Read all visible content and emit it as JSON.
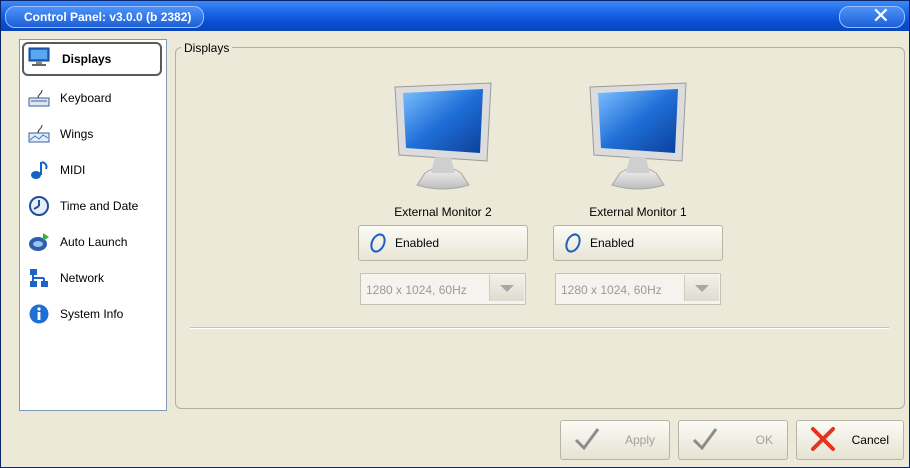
{
  "window": {
    "title": "Control Panel: v3.0.0 (b 2382)"
  },
  "sidebar": {
    "items": [
      {
        "label": "Displays",
        "icon": "monitor-icon",
        "selected": true
      },
      {
        "label": "Keyboard",
        "icon": "keyboard-icon"
      },
      {
        "label": "Wings",
        "icon": "wings-icon"
      },
      {
        "label": "MIDI",
        "icon": "midi-note-icon"
      },
      {
        "label": "Time and Date",
        "icon": "clock-icon"
      },
      {
        "label": "Auto Launch",
        "icon": "auto-launch-icon"
      },
      {
        "label": "Network",
        "icon": "network-icon"
      },
      {
        "label": "System Info",
        "icon": "info-icon"
      }
    ]
  },
  "displays": {
    "group_label": "Displays",
    "monitors": [
      {
        "name": "External Monitor 2",
        "status": "Enabled",
        "resolution": "1280 x 1024, 60Hz"
      },
      {
        "name": "External Monitor 1",
        "status": "Enabled",
        "resolution": "1280 x 1024, 60Hz"
      }
    ]
  },
  "footer": {
    "apply_label": "Apply",
    "ok_label": "OK",
    "cancel_label": "Cancel"
  },
  "colors": {
    "titlebar": "#1a64e6",
    "panel": "#ece9d8",
    "cancel_x": "#e8341c",
    "check_gray": "#8c8c8c"
  }
}
